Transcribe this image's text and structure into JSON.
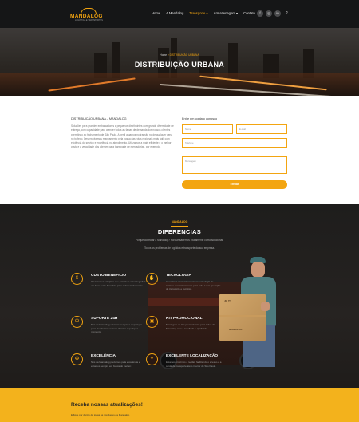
{
  "header": {
    "logo_text": "MANDALOG",
    "logo_sub": "LOGÍSTICA E TRANSPORTES",
    "nav": [
      {
        "label": "Home",
        "active": false
      },
      {
        "label": "A Mandalog",
        "active": false
      },
      {
        "label": "Transporte ▾",
        "active": true
      },
      {
        "label": "Armazenagem ▾",
        "active": false
      },
      {
        "label": "Contato",
        "active": false
      }
    ],
    "social_icons": [
      "facebook-icon",
      "instagram-icon",
      "linkedin-icon"
    ],
    "search_icon": "search-icon"
  },
  "hero": {
    "breadcrumb_home": "Home",
    "breadcrumb_current": "» DISTRIBUIÇÃO URBANA",
    "title": "DISTRIBUIÇÃO URBANA"
  },
  "intro": {
    "heading": "DISTRIBUIÇÃO URBANA – MANDALOG",
    "paragraph": "Soluções para grandes embarcadores a pequenos distribuintes com grande diversidade de entrega, com capacidade para atender todas as faixas de demanda dos nossos clientes permitindo ao fechamento de São Paulo. A perfil atuamos no transito no de qualquer cena no tráfego. Desenvolvemos mapeamento pela nossa das rotas regionais mais ágil, com eficiência do serviço e excelência no atendimento. Utilizamos a mais eficiente e o melhor custo e a velocidade dos clientes para transporte de mercadorias, por exemplo.",
    "form_heading": "Entre em contato conosco",
    "form": {
      "name_placeholder": "Nome",
      "email_placeholder": "E-mail",
      "phone_placeholder": "Telefone",
      "message_placeholder": "Mensagem",
      "submit_label": "Enviar"
    }
  },
  "services": {
    "eyebrow": "MANDALOG",
    "title": "DIFERENCIAS",
    "subtitle": "Porque contratar a Mandalog? Porque sabemos exatamente como solucionar.",
    "subtitle2": "Todos os problemas de logística e transporte da sua empresa.",
    "features": [
      {
        "icon": "dollar-icon",
        "title": "CUSTO BENEFICIO",
        "desc": "Oferecemos soluções que garantem a sua logística um bom custo-benefício para o desenvolvimento."
      },
      {
        "icon": "handshake-icon",
        "title": "TECNOLOGIA",
        "desc": "Investimos constantemente na tecnologia de rastreio e monitoramento para toda a sua operação de transporte e logística."
      },
      {
        "icon": "headset-icon",
        "title": "SUPORTE 24H",
        "desc": "Nós da Mandalog estamos sempre a disposição para atender aos nossos clientes a qualquer momento."
      },
      {
        "icon": "box-icon",
        "title": "KIT PROMOCIONAL",
        "desc": "Montagem de kits promocionais para todos da Mandalog com o resultado e qualidade."
      },
      {
        "icon": "medal-icon",
        "title": "EXCELÊNCIA",
        "desc": "Nós da Mandalog prezamos pela excelência e estamos sempre em busca do melhor."
      },
      {
        "icon": "location-icon",
        "title": "EXCELENTE LOCALIZAÇÃO",
        "desc": "Estamos próximos à região, facilitando o acesso e a saída de transporte até o interior de São Paulo."
      }
    ],
    "box_label": "MANDALOG"
  },
  "newsletter": {
    "title": "Receba nossas atualizações!",
    "subtitle": "E fique por dentro de todas as novidades da Mandalog."
  },
  "colors": {
    "accent": "#f3a511",
    "dark": "#151617",
    "news_bg": "#f3b21c"
  }
}
